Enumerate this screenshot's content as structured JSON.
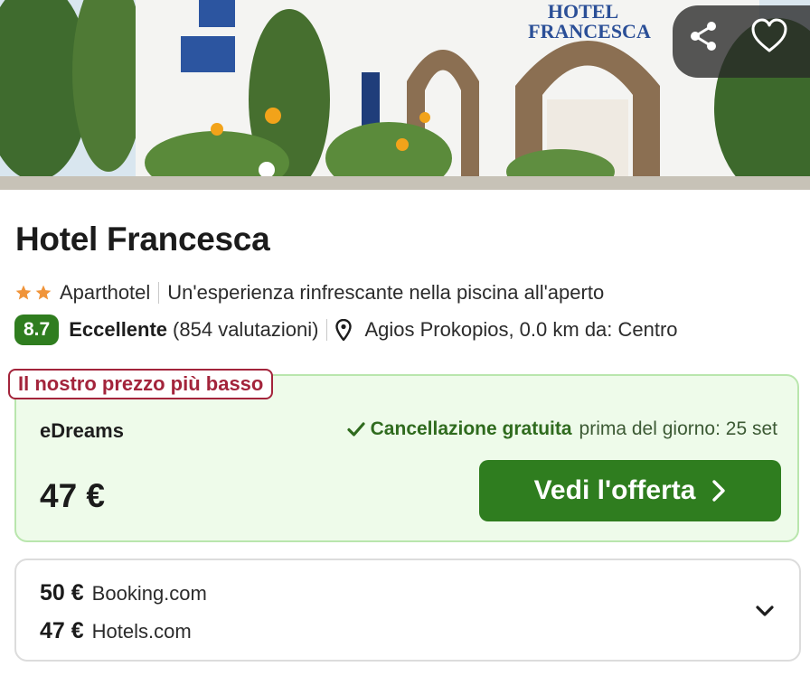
{
  "hero": {
    "hotel_sign_line1": "HOTEL",
    "hotel_sign_line2": "FRANCESCA",
    "share_icon": "share-icon",
    "favorite_icon": "heart-icon"
  },
  "hotel": {
    "name": "Hotel Francesca",
    "stars": 2,
    "type": "Aparthotel",
    "highlight": "Un'esperienza rinfrescante nella piscina all'aperto",
    "score": "8.7",
    "rating_word": "Eccellente",
    "reviews": "(854 valutazioni)",
    "location": "Agios Prokopios, 0.0 km da: Centro"
  },
  "best_offer": {
    "tag": "Il nostro prezzo più basso",
    "provider": "eDreams",
    "cancellation_strong": "Cancellazione gratuita",
    "cancellation_rest": "prima del giorno: 25 set",
    "price": "47 €",
    "cta_label": "Vedi l'offerta"
  },
  "other_offers": [
    {
      "price": "50 €",
      "provider": "Booking.com"
    },
    {
      "price": "47 €",
      "provider": "Hotels.com"
    }
  ],
  "colors": {
    "accent_green": "#2f7d1f",
    "tag_red": "#a3243b",
    "star_orange": "#f0943a",
    "card_green_bg": "#eefbea"
  }
}
